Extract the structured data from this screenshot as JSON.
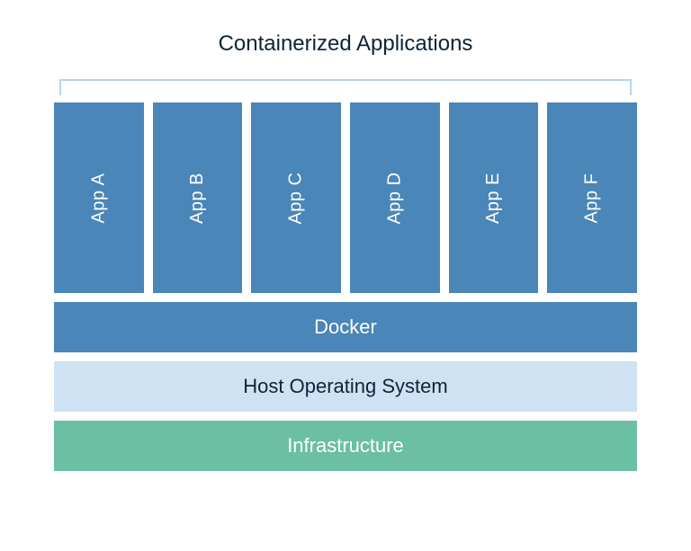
{
  "title": "Containerized Applications",
  "apps": {
    "a": "App A",
    "b": "App B",
    "c": "App C",
    "d": "App D",
    "e": "App E",
    "f": "App F"
  },
  "layers": {
    "docker": "Docker",
    "host_os": "Host Operating System",
    "infrastructure": "Infrastructure"
  },
  "colors": {
    "app_blue": "#4a86b8",
    "light_blue": "#cfe2f3",
    "green": "#6bbfa3",
    "title_text": "#0d2436",
    "bracket": "#b7d4ef"
  }
}
